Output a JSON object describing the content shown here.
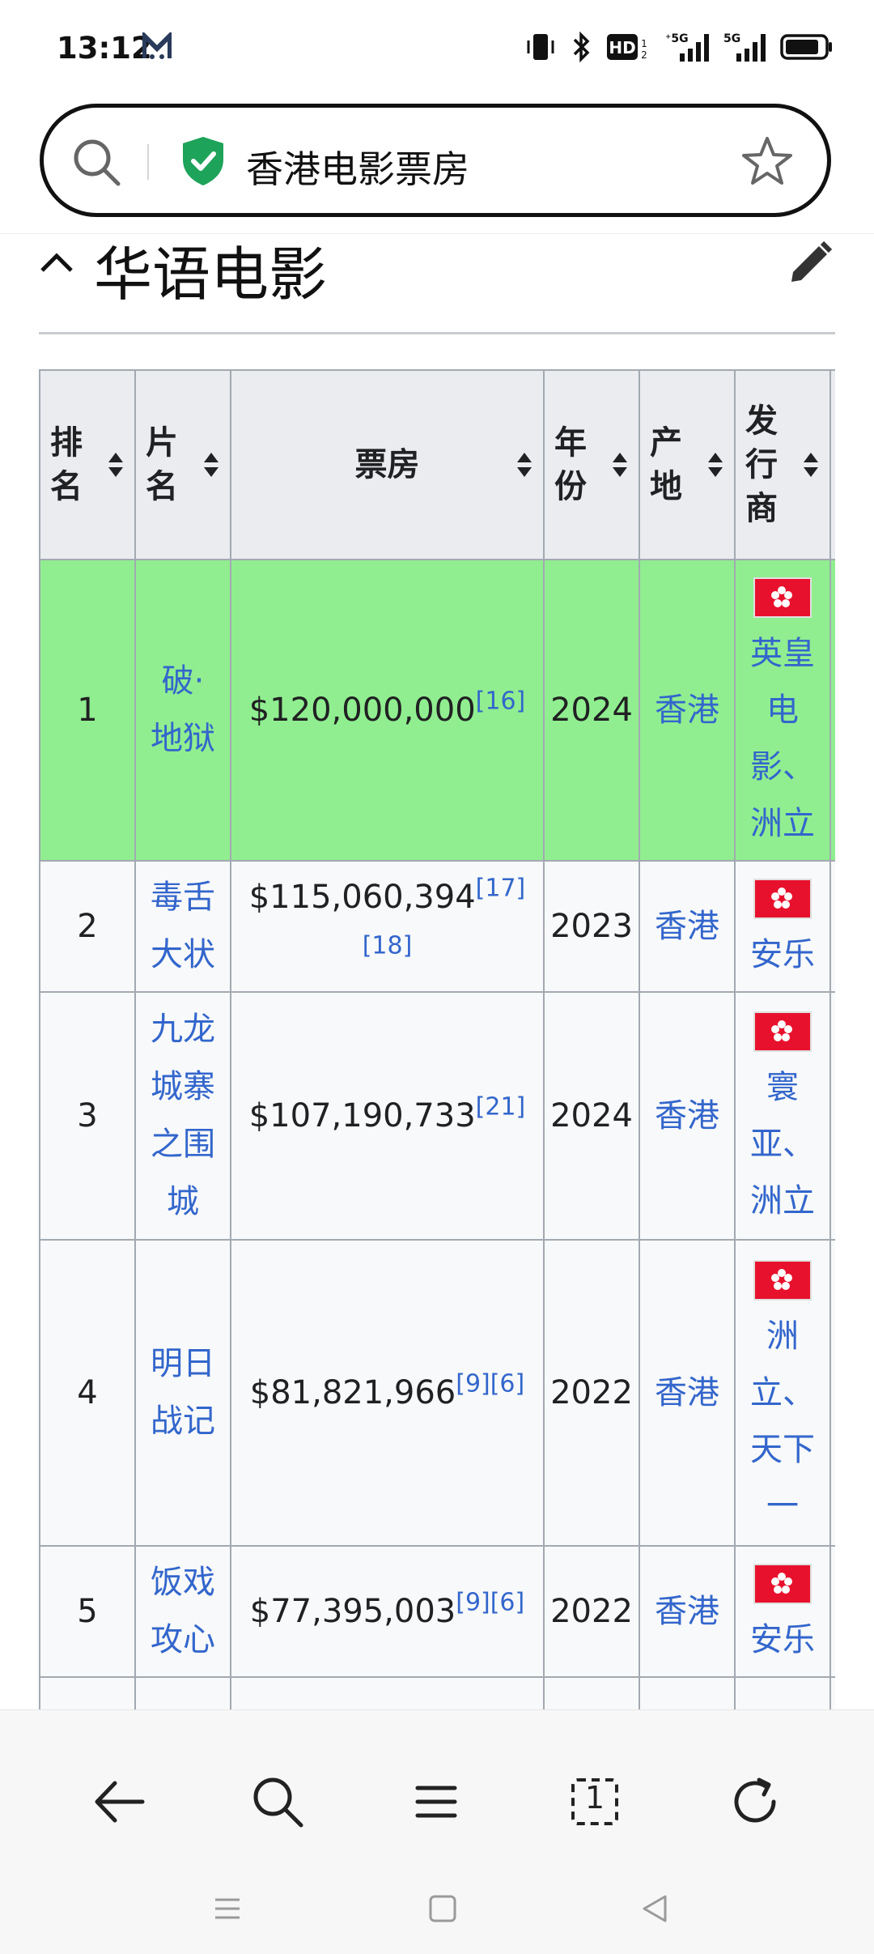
{
  "status": {
    "time": "13:12",
    "icons": [
      "app-m-icon",
      "vibrate-icon",
      "bluetooth-icon",
      "hd-icon",
      "signal-5g-icon",
      "signal-5g-icon",
      "battery-icon"
    ]
  },
  "address_bar": {
    "text": "香港电影票房",
    "icons": [
      "search-icon",
      "shield-check-icon",
      "star-icon"
    ]
  },
  "section": {
    "title": "华语电影"
  },
  "table": {
    "headers": [
      "排名",
      "片名",
      "票房",
      "年份",
      "产地",
      "发行商"
    ],
    "rows": [
      {
        "rank": "1",
        "title": "破·地狱",
        "gross": "$120,000,000",
        "refs": "[16]",
        "year": "2024",
        "origin": "香港",
        "distributor": "英皇电影、洲立",
        "highlight": true
      },
      {
        "rank": "2",
        "title": "毒舌大状",
        "gross": "$115,060,394",
        "refs": "[17][18]",
        "year": "2023",
        "origin": "香港",
        "distributor": "安乐",
        "highlight": false
      },
      {
        "rank": "3",
        "title": "九龙城寨之围城",
        "gross": "$107,190,733",
        "refs": "[21]",
        "year": "2024",
        "origin": "香港",
        "distributor": "寰亚、洲立",
        "highlight": false
      },
      {
        "rank": "4",
        "title": "明日战记",
        "gross": "$81,821,966",
        "refs": "[9][6]",
        "year": "2022",
        "origin": "香港",
        "distributor": "洲立、天下一",
        "highlight": false
      },
      {
        "rank": "5",
        "title": "饭戏攻心",
        "gross": "$77,395,003",
        "refs": "[9][6]",
        "year": "2022",
        "origin": "香港",
        "distributor": "安乐",
        "highlight": false
      }
    ]
  },
  "bottom_nav": {
    "icons": [
      "back-arrow-icon",
      "search-icon",
      "menu-icon",
      "tabs-icon",
      "refresh-icon"
    ],
    "tab_count": "1"
  },
  "colors": {
    "link": "#3366cc",
    "highlight_row": "#90ee90",
    "header_bg": "#eaecf0",
    "cell_bg": "#f8f9fa",
    "border": "#a2a9b1",
    "shield": "#1ea35a",
    "flag_red": "#e8112d"
  }
}
